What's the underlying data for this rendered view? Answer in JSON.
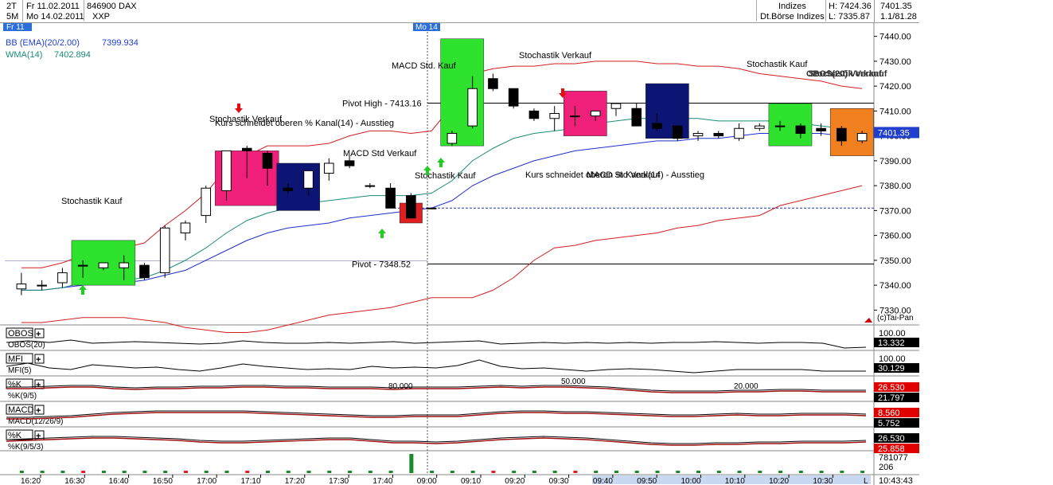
{
  "header": {
    "interval1": "2T",
    "date1": "Fr 11.02.2011",
    "wkn": "846900",
    "symbol": "DAX",
    "interval2": "5M",
    "date2": "Mo 14.02.2011",
    "code": "XXP",
    "category": "Indizes",
    "exchange": "Dt.Börse Indizes",
    "high": "H: 7424.36",
    "low": "L: 7335.87",
    "last": "7401.35",
    "ratio": "1.1/81.28"
  },
  "day_tags": [
    "Fr  11",
    "Mo 14"
  ],
  "indicator_labels": {
    "bb": "BB (EMA)(20/2.00)",
    "bb_value": "7399.934",
    "wma": "WMA(14)",
    "wma_value": "7402.894"
  },
  "price_axis": {
    "ticks": [
      "7440.00",
      "7430.00",
      "7420.00",
      "7410.00",
      "7400.00",
      "7390.00",
      "7380.00",
      "7370.00",
      "7360.00",
      "7350.00",
      "7340.00",
      "7330.00"
    ],
    "last_tag": "7401.35",
    "copyright": "(c)Tai-Pan"
  },
  "annotations": {
    "pivot_high": "Pivot High - 7413.16",
    "pivot": "Pivot - 7348.52",
    "texts": [
      "Stochastik Kauf",
      "Stochastik Verkauf",
      "Kurs schneidet oberen % Kanal(14) - Ausstieg",
      "MACD Std Verkauf",
      "MACD Std. Kauf",
      "Stochastik Kauf",
      "Stochastik Verkauf",
      "Kurs schneidet oberen % Kanal(14) - Ausstieg",
      "MACD Std Verkauf",
      "Stochastik Kauf",
      "OBOS(20) Verkauf",
      "Stochastik Verkauf"
    ]
  },
  "subpanels": [
    {
      "name": "OBOS",
      "sub": "OBOS(20)",
      "top": "100.00",
      "tag": "13.332",
      "tag_color": "#000000"
    },
    {
      "name": "MFI",
      "sub": "MFI(5)",
      "top": "100.00",
      "tag": "30.129",
      "tag_color": "#000000"
    },
    {
      "name": "%K",
      "sub": "%K(9/5)",
      "top": "",
      "tag": "26.530",
      "tag_color": "#e00000",
      "tag2": "21.797",
      "tag2_color": "#000000",
      "levels": [
        "50.000",
        "80.000",
        "20.000"
      ]
    },
    {
      "name": "MACD",
      "sub": "MACD(12/26/9)",
      "top": "",
      "tag": "8.560",
      "tag_color": "#e00000",
      "tag2": "5.752",
      "tag2_color": "#000000"
    },
    {
      "name": "%K",
      "sub": "%K(9/5/3)",
      "top": "",
      "tag": "26.530",
      "tag_color": "#000000",
      "tag2": "25.858",
      "tag2_color": "#e00000"
    }
  ],
  "volume": {
    "top": "781077",
    "bottom": "206"
  },
  "time_axis": {
    "labels": [
      "16:20",
      "16:30",
      "16:40",
      "16:50",
      "17:00",
      "17:10",
      "17:20",
      "17:30",
      "17:40",
      "09:00",
      "09:10",
      "09:20",
      "09:30",
      "09:40",
      "09:50",
      "10:00",
      "10:10",
      "10:20",
      "10:30"
    ],
    "current_time": "10:43:43",
    "end_marker": "L"
  },
  "chart_data": {
    "type": "candlestick",
    "ylim": [
      7325,
      7445
    ],
    "candles": [
      {
        "o": 7338.5,
        "h": 7345,
        "l": 7336,
        "c": 7340.5
      },
      {
        "o": 7340,
        "h": 7342,
        "l": 7338,
        "c": 7340
      },
      {
        "o": 7341,
        "h": 7347,
        "l": 7339,
        "c": 7345
      },
      {
        "o": 7348,
        "h": 7350,
        "l": 7343,
        "c": 7348
      },
      {
        "o": 7347,
        "h": 7349,
        "l": 7346,
        "c": 7349
      },
      {
        "o": 7347,
        "h": 7352,
        "l": 7342,
        "c": 7349
      },
      {
        "o": 7348,
        "h": 7349,
        "l": 7342,
        "c": 7343
      },
      {
        "o": 7345,
        "h": 7364,
        "l": 7343,
        "c": 7363
      },
      {
        "o": 7361,
        "h": 7366,
        "l": 7358,
        "c": 7365
      },
      {
        "o": 7368,
        "h": 7380,
        "l": 7365,
        "c": 7379
      },
      {
        "o": 7378,
        "h": 7391,
        "l": 7374,
        "c": 7394
      },
      {
        "o": 7395,
        "h": 7396,
        "l": 7383,
        "c": 7394
      },
      {
        "o": 7393,
        "h": 7394,
        "l": 7380,
        "c": 7387
      },
      {
        "o": 7379,
        "h": 7381,
        "l": 7377,
        "c": 7378
      },
      {
        "o": 7379,
        "h": 7382,
        "l": 7376,
        "c": 7386
      },
      {
        "o": 7385,
        "h": 7391,
        "l": 7382,
        "c": 7389
      },
      {
        "o": 7390,
        "h": 7392,
        "l": 7387,
        "c": 7388
      },
      {
        "o": 7380,
        "h": 7381,
        "l": 7379,
        "c": 7380
      },
      {
        "o": 7379,
        "h": 7381,
        "l": 7371,
        "c": 7371
      },
      {
        "o": 7376,
        "h": 7377,
        "l": 7367,
        "c": 7367
      },
      {
        "o": 7371,
        "h": 7371,
        "l": 7371,
        "c": 7371
      },
      {
        "o": 7397,
        "h": 7402,
        "l": 7396,
        "c": 7401
      },
      {
        "o": 7404,
        "h": 7424,
        "l": 7403,
        "c": 7419
      },
      {
        "o": 7423,
        "h": 7425,
        "l": 7418,
        "c": 7419
      },
      {
        "o": 7419,
        "h": 7419,
        "l": 7411,
        "c": 7412
      },
      {
        "o": 7410,
        "h": 7411,
        "l": 7406,
        "c": 7407
      },
      {
        "o": 7407,
        "h": 7412,
        "l": 7402,
        "c": 7409
      },
      {
        "o": 7408,
        "h": 7412,
        "l": 7404,
        "c": 7408
      },
      {
        "o": 7408,
        "h": 7410,
        "l": 7406,
        "c": 7410
      },
      {
        "o": 7411,
        "h": 7413,
        "l": 7408,
        "c": 7413
      },
      {
        "o": 7411,
        "h": 7413,
        "l": 7404,
        "c": 7404
      },
      {
        "o": 7405,
        "h": 7409,
        "l": 7402,
        "c": 7403
      },
      {
        "o": 7404,
        "h": 7404,
        "l": 7398,
        "c": 7399
      },
      {
        "o": 7400,
        "h": 7402,
        "l": 7398,
        "c": 7401
      },
      {
        "o": 7401,
        "h": 7402,
        "l": 7399,
        "c": 7400
      },
      {
        "o": 7399,
        "h": 7405,
        "l": 7398,
        "c": 7403
      },
      {
        "o": 7403,
        "h": 7405,
        "l": 7402,
        "c": 7404
      },
      {
        "o": 7404,
        "h": 7406,
        "l": 7402,
        "c": 7404
      },
      {
        "o": 7404,
        "h": 7405,
        "l": 7399,
        "c": 7401
      },
      {
        "o": 7403,
        "h": 7405,
        "l": 7400,
        "c": 7402
      },
      {
        "o": 7403,
        "h": 7404,
        "l": 7396,
        "c": 7398
      },
      {
        "o": 7398,
        "h": 7402,
        "l": 7397,
        "c": 7401
      }
    ],
    "bb_upper": [
      7347,
      7347,
      7349,
      7352,
      7355,
      7355,
      7357,
      7364,
      7370,
      7377,
      7387,
      7392,
      7396,
      7396,
      7396,
      7397,
      7400,
      7402,
      7402,
      7401,
      7402,
      7412,
      7425,
      7427,
      7428,
      7428,
      7429,
      7429,
      7430,
      7430,
      7430,
      7429,
      7429,
      7428,
      7428,
      7427,
      7425,
      7424,
      7423,
      7422,
      7420,
      7419
    ],
    "bb_lower": [
      7325,
      7325,
      7326,
      7327,
      7327,
      7327,
      7326,
      7325,
      7323,
      7322,
      7321,
      7321,
      7322,
      7324,
      7326,
      7328,
      7329,
      7330,
      7331,
      7333,
      7335,
      7335,
      7335,
      7338,
      7343,
      7350,
      7355,
      7356,
      7358,
      7359,
      7360,
      7361,
      7363,
      7364,
      7366,
      7367,
      7368,
      7372,
      7374,
      7376,
      7378,
      7380
    ],
    "bb_mid": [
      7338,
      7338,
      7339,
      7340,
      7341,
      7341,
      7342,
      7344,
      7346,
      7350,
      7354,
      7358,
      7361,
      7363,
      7364,
      7365,
      7367,
      7368,
      7369,
      7370,
      7371,
      7374,
      7380,
      7384,
      7387,
      7390,
      7392,
      7394,
      7395,
      7396,
      7397,
      7398,
      7398,
      7399,
      7399,
      7400,
      7401,
      7401,
      7401,
      7401,
      7400,
      7400
    ],
    "wma": [
      7338,
      7338,
      7339,
      7341,
      7342,
      7342,
      7343,
      7346,
      7350,
      7355,
      7361,
      7366,
      7369,
      7371,
      7373,
      7374,
      7375,
      7376,
      7376,
      7376,
      7377,
      7382,
      7390,
      7395,
      7399,
      7401,
      7402,
      7403,
      7405,
      7406,
      7407,
      7407,
      7407,
      7407,
      7406,
      7406,
      7406,
      7406,
      7405,
      7404,
      7403,
      7403
    ],
    "volume": [
      1,
      1,
      1,
      1,
      1,
      1,
      1,
      1,
      1,
      1,
      1,
      1,
      1,
      1,
      1,
      1,
      1,
      1,
      1,
      8,
      1,
      1,
      1,
      1,
      1,
      1,
      1,
      1,
      1,
      1,
      1,
      1,
      1,
      1,
      1,
      1,
      1,
      1,
      1,
      1,
      1,
      1
    ],
    "volume_colors": [
      "g",
      "g",
      "g",
      "r",
      "g",
      "g",
      "g",
      "g",
      "r",
      "g",
      "g",
      "r",
      "g",
      "g",
      "g",
      "g",
      "g",
      "g",
      "g",
      "g",
      "g",
      "g",
      "g",
      "r",
      "g",
      "g",
      "g",
      "r",
      "g",
      "g",
      "g",
      "g",
      "g",
      "g",
      "g",
      "g",
      "g",
      "g",
      "g",
      "g",
      "g",
      "g"
    ]
  }
}
